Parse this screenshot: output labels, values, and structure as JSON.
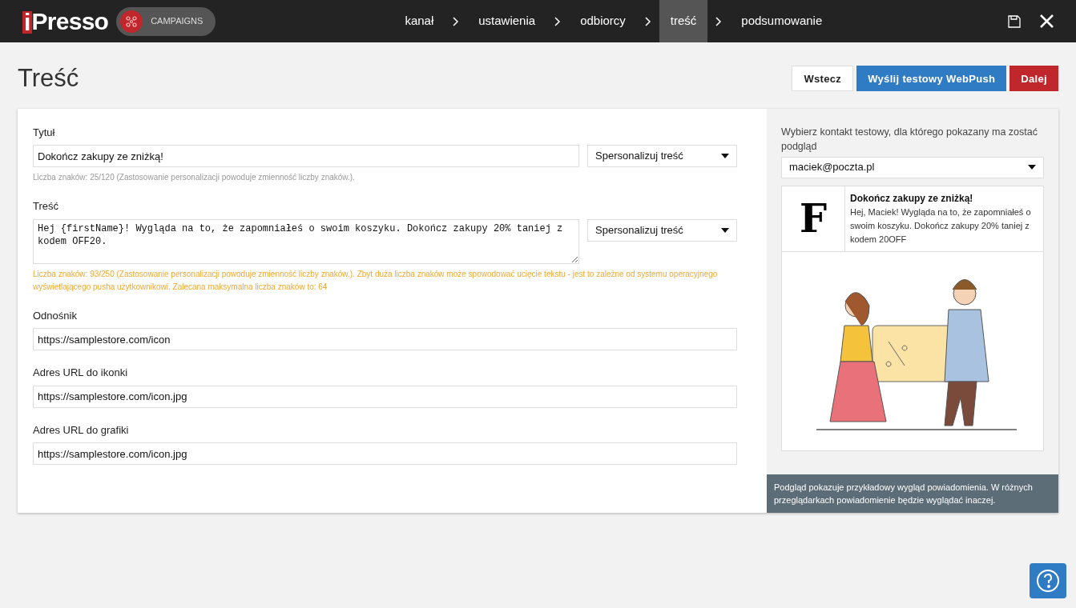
{
  "topbar": {
    "logo": {
      "mark": "i",
      "rest": "Presso"
    },
    "module": "CAMPAIGNS",
    "steps": [
      {
        "label": "kanał",
        "selected": false
      },
      {
        "label": "ustawienia",
        "selected": false
      },
      {
        "label": "odbiorcy",
        "selected": false
      },
      {
        "label": "treść",
        "selected": true
      },
      {
        "label": "podsumowanie",
        "selected": false
      }
    ]
  },
  "page": {
    "title": "Treść",
    "buttons": [
      {
        "label": "Wstecz",
        "kind": "default"
      },
      {
        "label": "Wyślij testowy WebPush",
        "kind": "primary"
      },
      {
        "label": "Dalej",
        "kind": "danger"
      }
    ]
  },
  "fields": [
    {
      "label": "Tytuł",
      "kind": "text",
      "value": "Dokończ zakupy ze zniżką!",
      "select": "Spersonalizuj treść",
      "hint": "Liczba znaków: 25/120 (Zastosowanie personalizacji powoduje zmienność liczby znaków.).",
      "warning": false
    },
    {
      "label": "Treść",
      "kind": "textarea",
      "value": "Hej {firstName}! Wygląda na to, że zapomniałeś o swoim koszyku. Dokończ zakupy 20% taniej z kodem OFF20.",
      "select": "Spersonalizuj treść",
      "hint": "Liczba znaków: 93/250 (Zastosowanie personalizacji powoduje zmienność liczby znaków.). Zbyt duża liczba znaków może spowodować ucięcie tekstu - jest to zależne od systemu operacyjnego wyświetlającego pusha użytkownikowi. Zalecana maksymalna liczba znaków to: 64",
      "warning": true
    },
    {
      "label": "Odnośnik",
      "kind": "text",
      "value": "https://samplestore.com/icon"
    },
    {
      "label": "Adres URL do ikonki",
      "kind": "text",
      "value": "https://samplestore.com/icon.jpg"
    },
    {
      "label": "Adres URL do grafiki",
      "kind": "text",
      "value": "https://samplestore.com/icon.jpg"
    }
  ],
  "preview": {
    "label": "Wybierz kontakt testowy, dla którego pokazany ma zostać podgląd",
    "contact": "maciek@poczta.pl",
    "icon_letter": "F",
    "title": "Dokończ zakupy ze zniżką!",
    "body": "Hej, Maciek! Wygląda na to, że zapomniałeś o swoim koszyku. Dokończ zakupy 20% taniej z kodem 20OFF",
    "note": "Podgląd pokazuje przykładowy wygląd powiadomienia. W różnych przeglądarkach powiadomienie będzie wyglądać inaczej."
  }
}
